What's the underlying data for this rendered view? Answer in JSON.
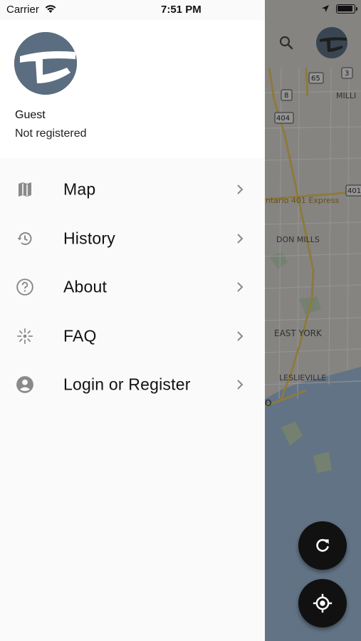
{
  "status_bar": {
    "carrier": "Carrier",
    "time": "7:51 PM"
  },
  "drawer": {
    "user": {
      "name": "Guest",
      "status": "Not registered"
    },
    "menu": [
      {
        "label": "Map",
        "icon": "map-icon"
      },
      {
        "label": "History",
        "icon": "history-icon"
      },
      {
        "label": "About",
        "icon": "help-circle-icon"
      },
      {
        "label": "FAQ",
        "icon": "sparkle-icon"
      },
      {
        "label": "Login or Register",
        "icon": "account-circle-icon"
      }
    ]
  },
  "map": {
    "labels": {
      "express": "ntario 401 Express",
      "don_mills": "DON MILLS",
      "east_york": "EAST YORK",
      "leslieville": "LESLIEVILLE",
      "millik": "MILLI",
      "o": "O"
    },
    "shields": [
      "8",
      "65",
      "3",
      "404",
      "401"
    ]
  },
  "colors": {
    "drawer_bg": "#fafafa",
    "header_bg": "#ffffff",
    "avatar": "#5b6d80",
    "fab": "#111111",
    "icon_gray": "#8a8a8a"
  }
}
